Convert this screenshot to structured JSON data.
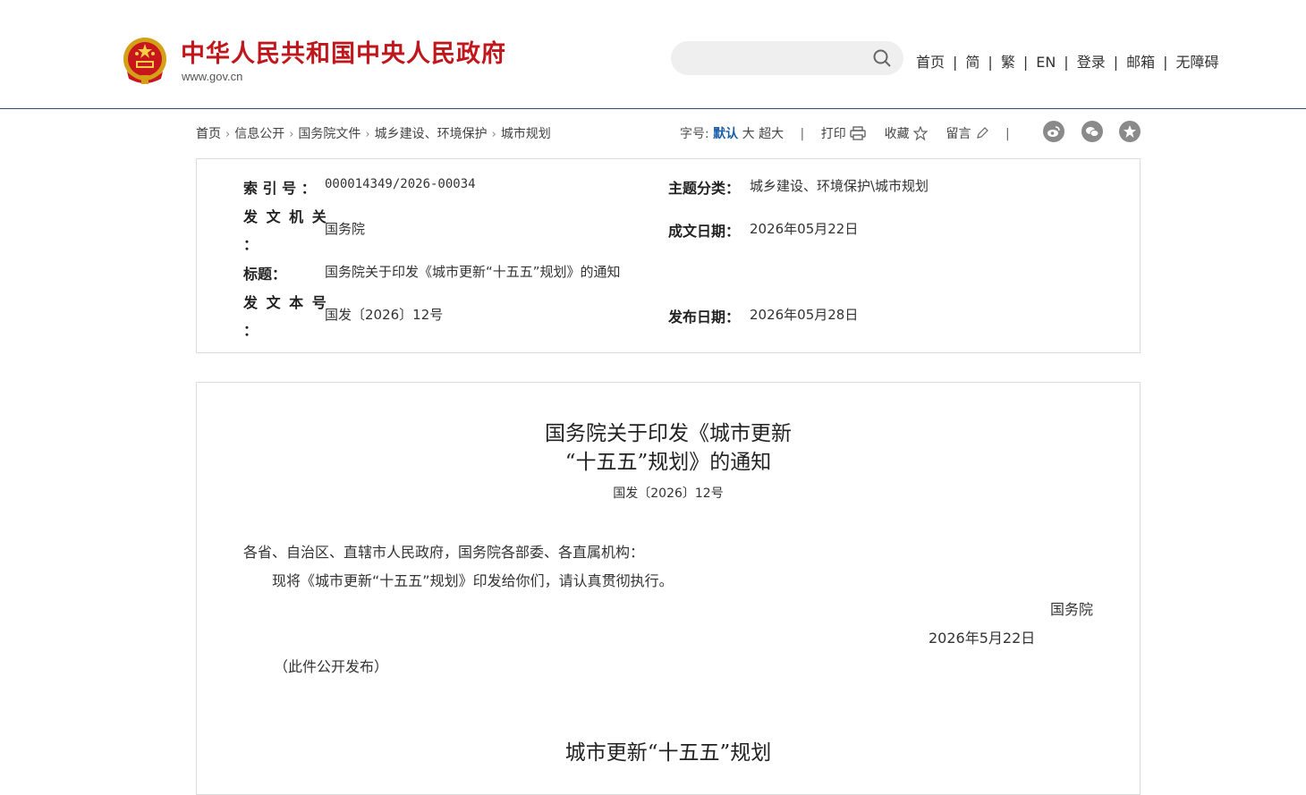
{
  "header": {
    "site_title": "中华人民共和国中央人民政府",
    "site_url": "www.gov.cn",
    "nav": [
      "首页",
      "简",
      "繁",
      "EN",
      "登录",
      "邮箱",
      "无障碍"
    ],
    "separator": "|"
  },
  "breadcrumb": [
    "首页",
    "信息公开",
    "国务院文件",
    "城乡建设、环境保护",
    "城市规划"
  ],
  "toolbar": {
    "font_size_label": "字号:",
    "font_default": "默认",
    "font_large": "大",
    "font_xlarge": "超大",
    "print": "打印",
    "favorite": "收藏",
    "comment": "留言",
    "separator": "|"
  },
  "share_icons": [
    "weibo-icon",
    "wechat-icon",
    "star-icon"
  ],
  "meta": {
    "index_label": "索 引 号 ：",
    "index_value": "000014349/2026-00034",
    "category_label": "主题分类：",
    "category_value": "城乡建设、环境保护\\城市规划",
    "issuer_label_top": "发 文 机 关",
    "issuer_label_colon": "：",
    "issuer_value": "国务院",
    "written_date_label": "成文日期：",
    "written_date_value": "2026年05月22日",
    "title_label": "标题：",
    "title_value": "国务院关于印发《城市更新“十五五”规划》的通知",
    "doc_no_label_top": "发 文 本 号",
    "doc_no_label_colon": "：",
    "doc_no_value": "国发〔2026〕12号",
    "publish_date_label": "发布日期：",
    "publish_date_value": "2026年05月28日"
  },
  "document": {
    "title_line1": "国务院关于印发《城市更新",
    "title_line2": "“十五五”规划》的通知",
    "number": "国发〔2026〕12号",
    "salutation": "各省、自治区、直辖市人民政府，国务院各部委、各直属机构：",
    "body": "现将《城市更新“十五五”规划》印发给你们，请认真贯彻执行。",
    "signature": "国务院",
    "date": "2026年5月22日",
    "note": "（此件公开发布）",
    "subtitle": "城市更新“十五五”规划"
  },
  "colors": {
    "brand_red": "#c0171d",
    "link_blue": "#1a5fa8",
    "border": "#dcdcdc"
  }
}
